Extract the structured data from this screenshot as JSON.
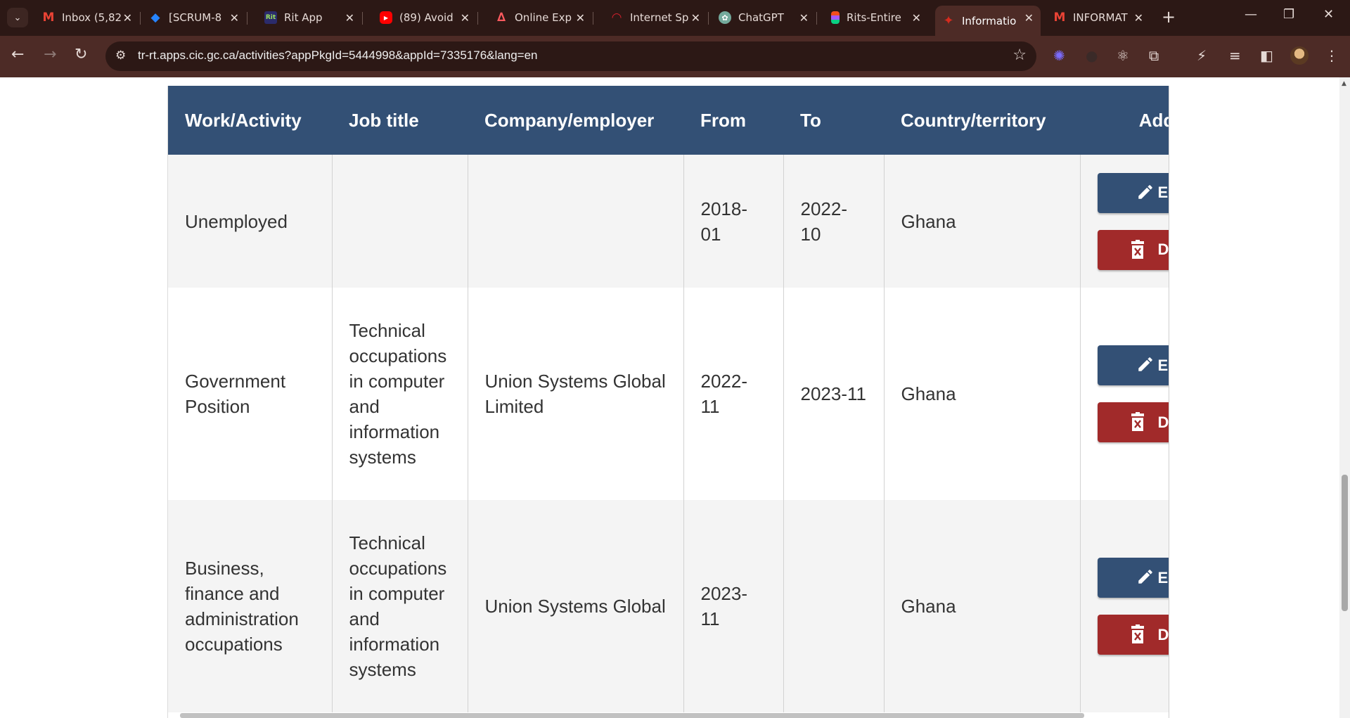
{
  "browser": {
    "tabs": [
      {
        "title": "Inbox (5,82",
        "icon": "gmail-icon",
        "color": "#ea4335"
      },
      {
        "title": "[SCRUM-8",
        "icon": "jira-icon",
        "color": "#2684ff"
      },
      {
        "title": "Rit App",
        "icon": "rit-icon",
        "color": "#2b2b6b"
      },
      {
        "title": "(89) Avoid",
        "icon": "youtube-icon",
        "color": "#ff0000"
      },
      {
        "title": "Online Exp",
        "icon": "airbnb-icon",
        "color": "#ff5a5f"
      },
      {
        "title": "Internet Sp",
        "icon": "speedtest-icon",
        "color": "#d4202c"
      },
      {
        "title": "ChatGPT",
        "icon": "chatgpt-icon",
        "color": "#74aa9c"
      },
      {
        "title": "Rits-Entire",
        "icon": "figma-icon",
        "color": "#a259ff"
      },
      {
        "title": "Informatio",
        "icon": "maple-leaf-icon",
        "color": "#d52b1e",
        "active": true
      },
      {
        "title": "INFORMAT",
        "icon": "gmail-icon",
        "color": "#ea4335"
      }
    ],
    "url": "tr-rt.apps.cic.gc.ca/activities?appPkgId=5444998&appId=7335176&lang=en"
  },
  "table": {
    "headers": {
      "activity": "Work/Activity",
      "job": "Job title",
      "company": "Company/employer",
      "from": "From",
      "to": "To",
      "country": "Country/territory",
      "actions": "Add or modify files"
    },
    "rows": [
      {
        "activity": "Unemployed",
        "job": "",
        "company": "",
        "from": "2018-01",
        "to": "2022-10",
        "country": "Ghana"
      },
      {
        "activity": "Government Position",
        "job": "Technical occupations in computer and information systems",
        "company": "Union Systems Global Limited",
        "from": "2022-11",
        "to": "2023-11",
        "country": "Ghana"
      },
      {
        "activity": "Business, finance and administration occupations",
        "job": "Technical occupations in computer and information systems",
        "company": "Union Systems Global",
        "from": "2023-11",
        "to": "",
        "country": "Ghana"
      }
    ],
    "edit_label": "Edit",
    "delete_label": "Delete",
    "colors": {
      "header": "#335075",
      "edit": "#335075",
      "delete": "#a12a2a"
    }
  }
}
